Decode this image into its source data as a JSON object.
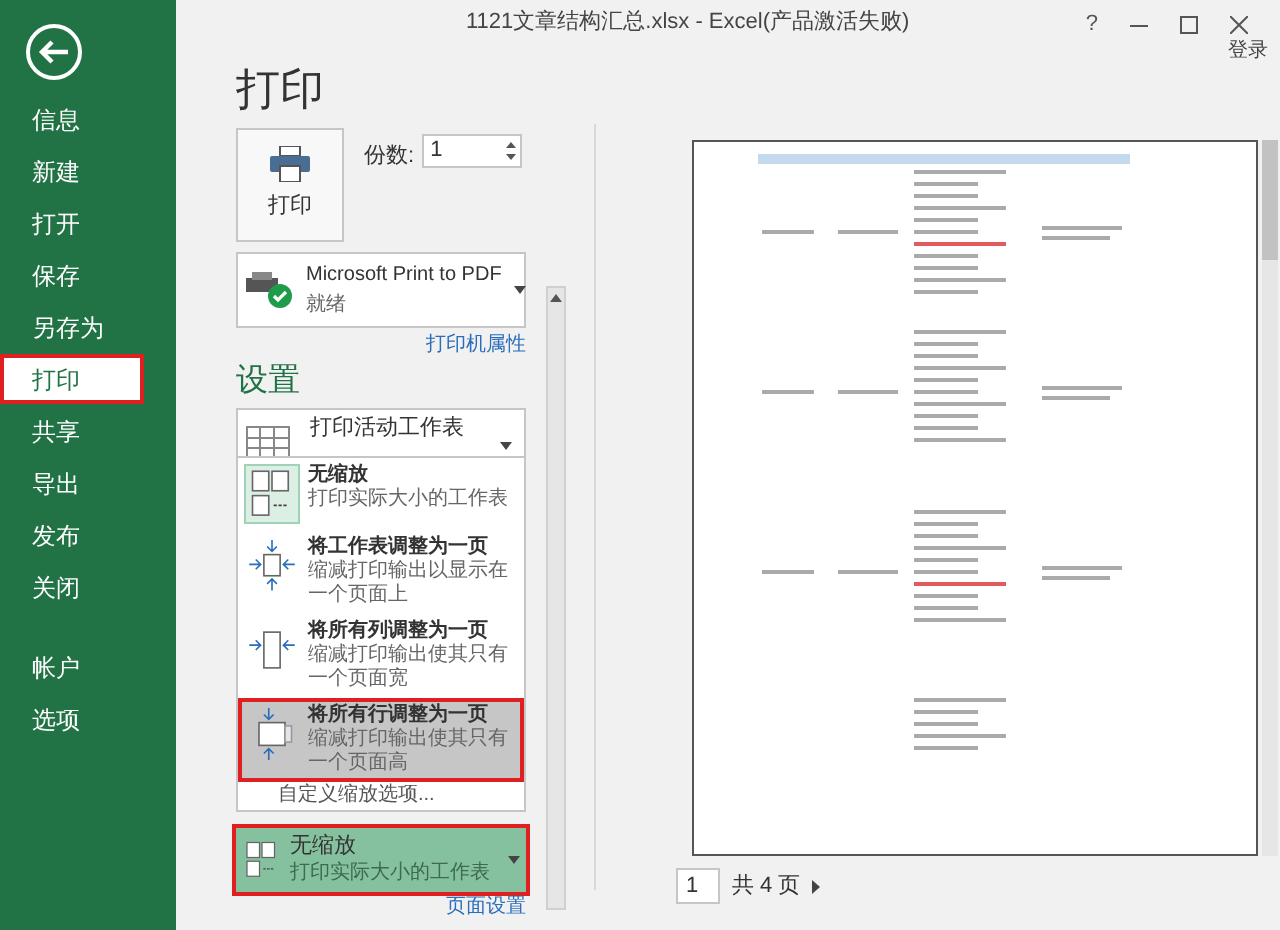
{
  "window": {
    "title": "1121文章结构汇总.xlsx - Excel(产品激活失败)",
    "help": "?",
    "sign_in": "登录"
  },
  "sidebar": {
    "items": [
      {
        "label": "信息",
        "selected": false,
        "annotated": false
      },
      {
        "label": "新建",
        "selected": false,
        "annotated": false
      },
      {
        "label": "打开",
        "selected": false,
        "annotated": false
      },
      {
        "label": "保存",
        "selected": false,
        "annotated": false
      },
      {
        "label": "另存为",
        "selected": false,
        "annotated": false
      },
      {
        "label": "打印",
        "selected": true,
        "annotated": true
      },
      {
        "label": "共享",
        "selected": false,
        "annotated": false
      },
      {
        "label": "导出",
        "selected": false,
        "annotated": false
      },
      {
        "label": "发布",
        "selected": false,
        "annotated": false
      },
      {
        "label": "关闭",
        "selected": false,
        "annotated": false
      }
    ],
    "footer_items": [
      {
        "label": "帐户",
        "selected": false,
        "annotated": false
      },
      {
        "label": "选项",
        "selected": false,
        "annotated": false
      }
    ]
  },
  "print": {
    "heading": "打印",
    "button": "打印",
    "copies_label": "份数:",
    "copies": "1"
  },
  "printer": {
    "name": "Microsoft Print to PDF",
    "status": "就绪",
    "properties_link": "打印机属性"
  },
  "settings": {
    "heading": "设置",
    "scope": {
      "title": "打印活动工作表"
    },
    "scaling_menu": [
      {
        "kind": "none",
        "title": "无缩放",
        "description": "打印实际大小的工作表",
        "selected": true,
        "highlighted": false,
        "annotated": false
      },
      {
        "kind": "sheet",
        "title": "将工作表调整为一页",
        "description": "缩减打印输出以显示在一个页面上",
        "selected": false,
        "highlighted": false,
        "annotated": false
      },
      {
        "kind": "columns",
        "title": "将所有列调整为一页",
        "description": "缩减打印输出使其只有一个页面宽",
        "selected": false,
        "highlighted": false,
        "annotated": false
      },
      {
        "kind": "rows",
        "title": "将所有行调整为一页",
        "description": "缩减打印输出使其只有一个页面高",
        "selected": false,
        "highlighted": true,
        "annotated": true
      }
    ],
    "custom_scaling": "自定义缩放选项...",
    "scaling": {
      "kind": "none",
      "title": "无缩放",
      "description": "打印实际大小的工作表",
      "annotated": true
    },
    "page_setup_link": "页面设置"
  },
  "preview": {
    "page": "1",
    "total": "共 4 页"
  }
}
